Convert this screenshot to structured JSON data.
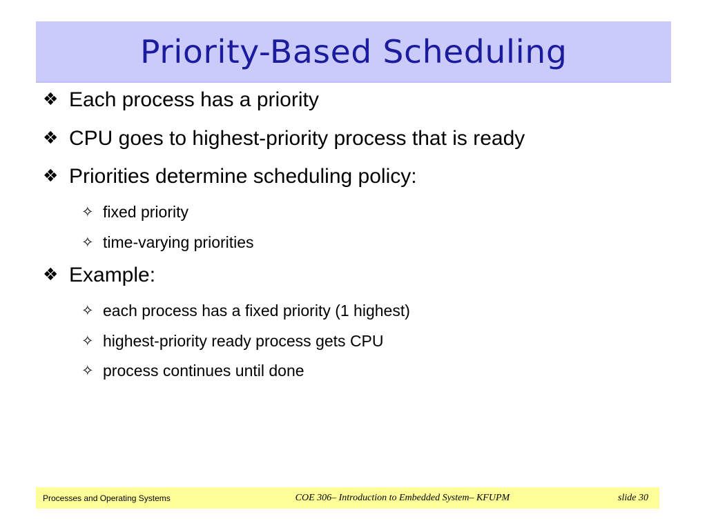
{
  "slide": {
    "title": "Priority-Based Scheduling",
    "title_band_color": "#cbcbfb",
    "title_text_color": "#1b1b9e",
    "background_color": "#ffffff"
  },
  "markers": {
    "level1": "❖",
    "level2": "✧",
    "level1_name": "diamond-cluster-bullet-icon",
    "level2_name": "four-pointed-star-bullet-icon"
  },
  "content": {
    "bullets": [
      {
        "level": 1,
        "text": "Each process has a priority"
      },
      {
        "level": 1,
        "text": "CPU goes to highest-priority process that is ready"
      },
      {
        "level": 1,
        "text": "Priorities determine scheduling policy:"
      },
      {
        "level": 2,
        "text": "fixed priority"
      },
      {
        "level": 2,
        "text": "time-varying priorities"
      },
      {
        "level": 1,
        "text": "Example:"
      },
      {
        "level": 2,
        "text": "each process has a fixed priority (1 highest)"
      },
      {
        "level": 2,
        "text": "highest-priority ready process gets CPU"
      },
      {
        "level": 2,
        "text": "process continues until done"
      }
    ]
  },
  "footer": {
    "left": "Processes and Operating Systems",
    "center": "COE 306– Introduction to Embedded System– KFUPM",
    "right": "slide 30",
    "band_color": "#ffff99"
  }
}
